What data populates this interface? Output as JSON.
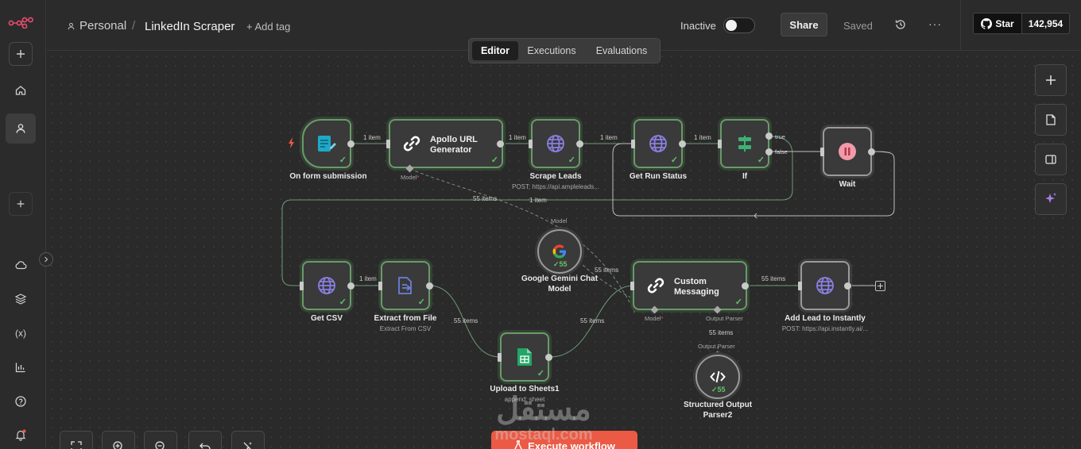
{
  "header": {
    "breadcrumb_project": "Personal",
    "breadcrumb_separator": "/",
    "workflow_name": "LinkedIn Scraper",
    "add_tag": "+ Add tag",
    "status_label": "Inactive",
    "share_label": "Share",
    "saved_label": "Saved",
    "github_star_label": "Star",
    "github_star_count": "142,954"
  },
  "tabs": [
    {
      "label": "Editor",
      "active": true
    },
    {
      "label": "Executions",
      "active": false
    },
    {
      "label": "Evaluations",
      "active": false
    }
  ],
  "nodes": {
    "form_trigger": {
      "label": "On form submission"
    },
    "apollo": {
      "label_line1": "Apollo URL",
      "label_line2": "Generator",
      "port": "Model",
      "port_required": "*"
    },
    "scrape": {
      "label": "Scrape Leads",
      "sub": "POST: https://api.ampleleads..."
    },
    "run_status": {
      "label": "Get Run Status"
    },
    "if_node": {
      "label": "If",
      "out_true": "true",
      "out_false": "false"
    },
    "wait": {
      "label": "Wait"
    },
    "get_csv": {
      "label": "Get CSV"
    },
    "extract": {
      "label": "Extract from File",
      "sub": "Extract From CSV"
    },
    "gemini": {
      "label_line1": "Google Gemini Chat",
      "label_line2": "Model",
      "port": "Model",
      "count": "55"
    },
    "custom": {
      "label_line1": "Custom",
      "label_line2": "Messaging",
      "port_model": "Model",
      "port_required": "*",
      "port_parser": "Output Parser"
    },
    "add_lead": {
      "label": "Add Lead to Instantly",
      "sub": "POST: https://api.instantly.ai/..."
    },
    "sheets": {
      "label": "Upload to Sheets1",
      "sub": "append: sheet"
    },
    "parser": {
      "label_line1": "Structured Output",
      "label_line2": "Parser2",
      "port": "Output Parser",
      "count": "55"
    }
  },
  "edge_labels": {
    "trigger_apollo": "1 item",
    "apollo_scrape": "1 item",
    "scrape_status": "1 item",
    "status_if": "1 item",
    "loop_back": "1 item",
    "apollo_csv": "55 items",
    "csv_extract": "1 item",
    "extract_sheets": "55 items",
    "sheets_custom": "55 items",
    "gemini_custom": "55 items",
    "custom_add": "55 items",
    "parser_custom": "55 items"
  },
  "bottom": {
    "execute_label": "Execute workflow"
  },
  "watermark": {
    "arabic": "مستقل",
    "latin": "mostaql.com"
  },
  "colors": {
    "accent": "#ea5a45",
    "success": "#62c16a",
    "canvas": "#2a2a2a"
  }
}
